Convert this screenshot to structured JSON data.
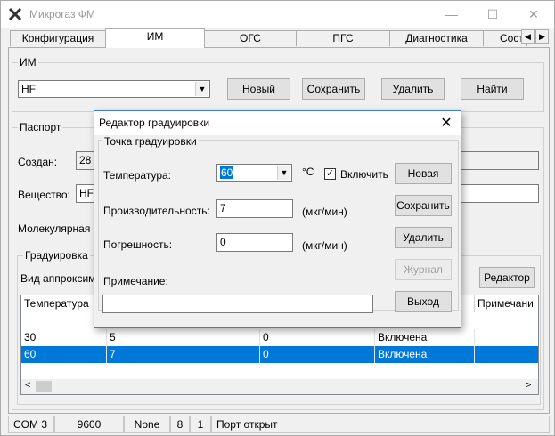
{
  "window": {
    "title": "Микрогаз ФМ",
    "minimize": "—",
    "maximize": "☐",
    "close": "✕"
  },
  "tabs": [
    "Конфигурация",
    "ИМ",
    "ОГС",
    "ПГС",
    "Диагностика",
    "Сост"
  ],
  "im_group": {
    "label": "ИМ",
    "selected": "HF",
    "buttons": {
      "new": "Новый",
      "save": "Сохранить",
      "delete": "Удалить",
      "find": "Найти"
    }
  },
  "passport": {
    "label": "Паспорт",
    "created_label": "Создан:",
    "created_value": "28 с",
    "substance_label": "Вещество:",
    "substance_value": "HF",
    "molar_label": "Молекулярная м"
  },
  "calibration": {
    "label": "Градуировка",
    "approx_label": "Вид аппроксим",
    "editor_button": "Редактор",
    "columns": [
      "Температура",
      "",
      "",
      "",
      "Примечани"
    ],
    "rows": [
      {
        "temp": "30",
        "perf": "5",
        "err": "0",
        "state": "Включена",
        "note": ""
      },
      {
        "temp": "60",
        "perf": "7",
        "err": "0",
        "state": "Включена",
        "note": ""
      }
    ],
    "scroll_left": "<",
    "scroll_right": ">"
  },
  "dialog": {
    "title": "Редактор градуировки",
    "close": "✕",
    "group_label": "Точка градуировки",
    "temperature_label": "Температура:",
    "temperature_value": "60",
    "temperature_unit": "°С",
    "enable_label": "Включить",
    "enable_checked": "✓",
    "performance_label": "Производительность:",
    "performance_value": "7",
    "performance_unit": "(мкг/мин)",
    "error_label": "Погрешность:",
    "error_value": "0",
    "error_unit": "(мкг/мин)",
    "note_label": "Примечание:",
    "note_value": "",
    "buttons": {
      "new": "Новая",
      "save": "Сохранить",
      "delete": "Удалить",
      "journal": "Журнал",
      "exit": "Выход"
    }
  },
  "status": {
    "port": "COM 3",
    "baud": "9600",
    "parity": "None",
    "bits": "8",
    "stop": "1",
    "state": "Порт открыт"
  }
}
